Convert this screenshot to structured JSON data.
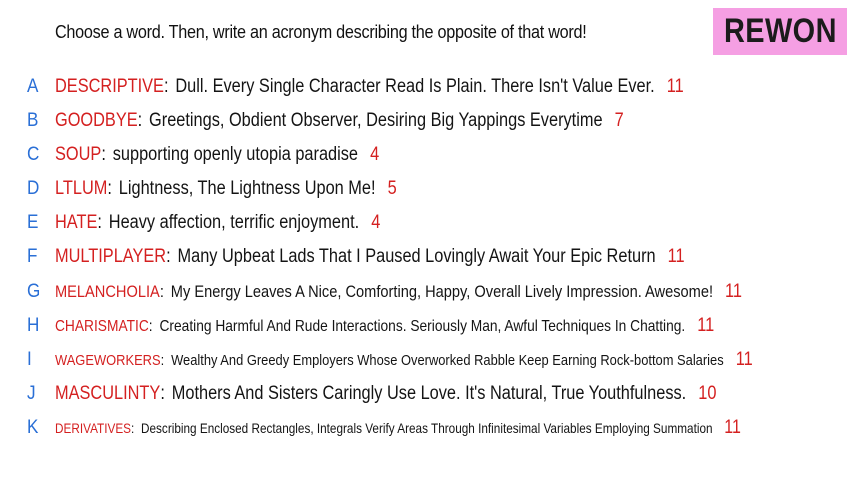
{
  "prompt": "Choose a word. Then, write an acronym describing the opposite of that word!",
  "logo": {
    "text": "REWON",
    "background": "#f59fe3"
  },
  "colors": {
    "letter": "#2a6fd6",
    "word": "#d42020",
    "acronym": "#141414",
    "count": "#d42020"
  },
  "entries": [
    {
      "letter": "A",
      "word": "DESCRIPTIVE",
      "acronym": "Dull. Every Single Character Read Is Plain. There Isn't Value Ever.",
      "count": "11"
    },
    {
      "letter": "B",
      "word": "GOODBYE",
      "acronym": "Greetings, Obdient Observer, Desiring Big Yappings Everytime",
      "count": "7"
    },
    {
      "letter": "C",
      "word": "SOUP",
      "acronym": "supporting openly utopia paradise",
      "count": "4"
    },
    {
      "letter": "D",
      "word": "LTLUM",
      "acronym": "Lightness, The Lightness Upon Me!",
      "count": "5"
    },
    {
      "letter": "E",
      "word": "HATE",
      "acronym": "Heavy affection, terrific enjoyment.",
      "count": "4"
    },
    {
      "letter": "F",
      "word": "MULTIPLAYER",
      "acronym": "Many Upbeat Lads That I Paused Lovingly Await Your Epic Return",
      "count": "11"
    },
    {
      "letter": "G",
      "word": "MELANCHOLIA",
      "acronym": "My Energy Leaves A Nice, Comforting, Happy, Overall Lively Impression. Awesome!",
      "count": "11"
    },
    {
      "letter": "H",
      "word": "CHARISMATIC",
      "acronym": "Creating Harmful And Rude Interactions. Seriously Man, Awful Techniques In Chatting.",
      "count": "11"
    },
    {
      "letter": "I",
      "word": "WAGEWORKERS",
      "acronym": "Wealthy And Greedy Employers Whose Overworked Rabble Keep Earning Rock-bottom Salaries",
      "count": "11"
    },
    {
      "letter": "J",
      "word": "MASCULINTY",
      "acronym": "Mothers And Sisters Caringly Use Love. It's Natural, True Youthfulness.",
      "count": "10"
    },
    {
      "letter": "K",
      "word": "DERIVATIVES",
      "acronym": "Describing Enclosed Rectangles, Integrals Verify Areas Through Infinitesimal Variables Employing Summation",
      "count": "11"
    }
  ]
}
